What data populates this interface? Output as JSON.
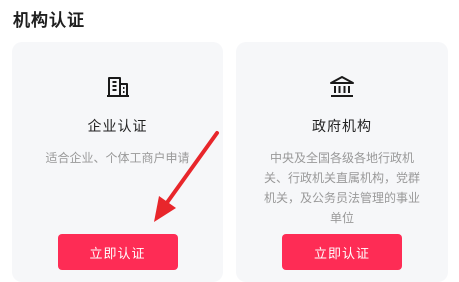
{
  "section": {
    "title": "机构认证"
  },
  "cards": [
    {
      "icon": "building-icon",
      "title": "企业认证",
      "desc": "适合企业、个体工商户申请",
      "button": "立即认证"
    },
    {
      "icon": "government-building-icon",
      "title": "政府机构",
      "desc": "中央及全国各级各地行政机关、行政机关直属机构，党群机关，及公务员法管理的事业单位",
      "button": "立即认证"
    }
  ],
  "colors": {
    "accent": "#fe2c55",
    "arrow": "#e8262b",
    "card_bg": "#f6f7f9"
  }
}
